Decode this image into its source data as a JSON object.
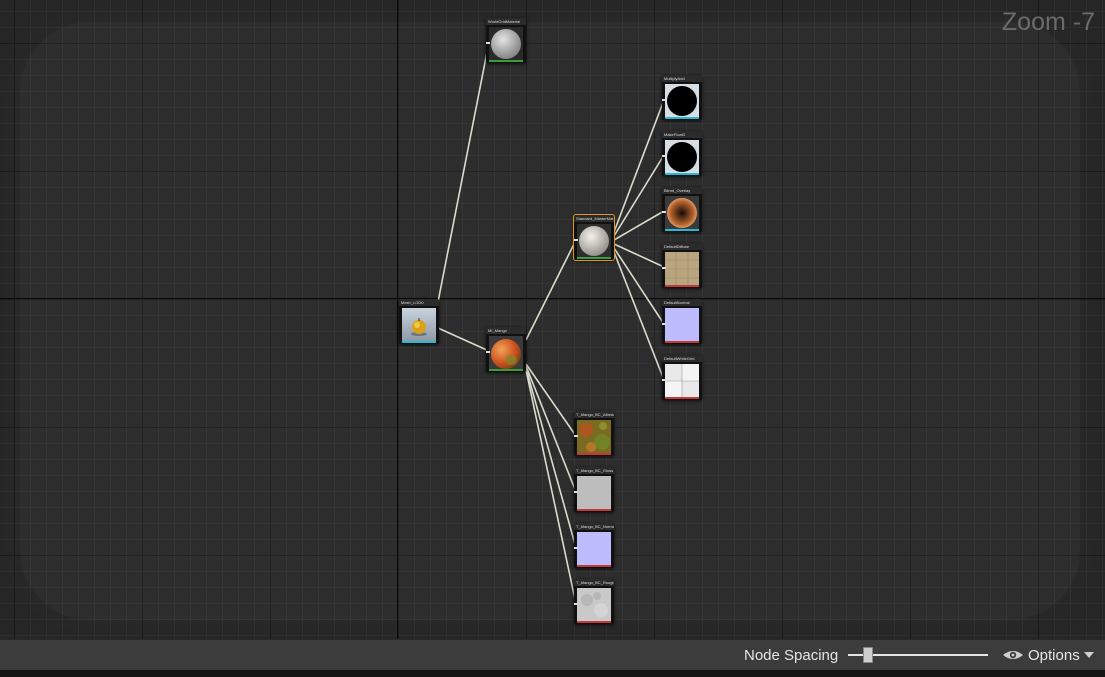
{
  "zoom_label": "Zoom -7",
  "bottom_bar": {
    "node_spacing_label": "Node Spacing",
    "node_spacing_value": 0.14,
    "options_label": "Options",
    "options_icon": "eye-icon",
    "dropdown_icon": "chevron-down-icon"
  },
  "colors": {
    "selected_outline": "#e3961d",
    "wire": "#d9dccb",
    "texture_bar_red": "#c23a3a",
    "texture_bar_cyan": "#29b8d4",
    "material_bar_green": "#3c9c3c"
  },
  "nodes": [
    {
      "id": "static_mesh",
      "title": "Mesh_LOD0",
      "thumb": "apple",
      "bar": "cyan"
    },
    {
      "id": "world_grid",
      "title": "WorldGridMaterial",
      "thumb": "sphere-grey",
      "bar": "green"
    },
    {
      "id": "apple_material",
      "title": "MI_Mango",
      "thumb": "apple-big",
      "bar": "green"
    },
    {
      "id": "master_material",
      "title": "Standard_MasterMat",
      "thumb": "sphere-white",
      "bar": "green",
      "selected": true
    },
    {
      "id": "multiply_add",
      "title": "MultiplyAdd",
      "thumb": "black-circle",
      "bar": "cyan"
    },
    {
      "id": "make_float",
      "title": "MakeFloat3",
      "thumb": "black-circle",
      "bar": "cyan"
    },
    {
      "id": "blend_overlay",
      "title": "Blend_Overlay",
      "thumb": "sphere-orange",
      "bar": "cyan"
    },
    {
      "id": "default_diffuse",
      "title": "DefaultDiffuse",
      "thumb": "texture-sand",
      "bar": "red"
    },
    {
      "id": "default_normal",
      "title": "DefaultNormal",
      "thumb": "lavender",
      "bar": "red"
    },
    {
      "id": "default_grid",
      "title": "DefaultWhiteGrid",
      "thumb": "white-grid",
      "bar": "red"
    },
    {
      "id": "tex_albedo",
      "title": "T_Mango_BC_Albedo",
      "thumb": "texture-leaf",
      "bar": "red"
    },
    {
      "id": "tex_gloss",
      "title": "T_Mango_BC_Gloss",
      "thumb": "grey",
      "bar": "red"
    },
    {
      "id": "tex_normal",
      "title": "T_Mango_BC_Normal",
      "thumb": "lavender",
      "bar": "red"
    },
    {
      "id": "tex_rough",
      "title": "T_Mango_BC_Rough",
      "thumb": "texture-rough",
      "bar": "red"
    }
  ]
}
